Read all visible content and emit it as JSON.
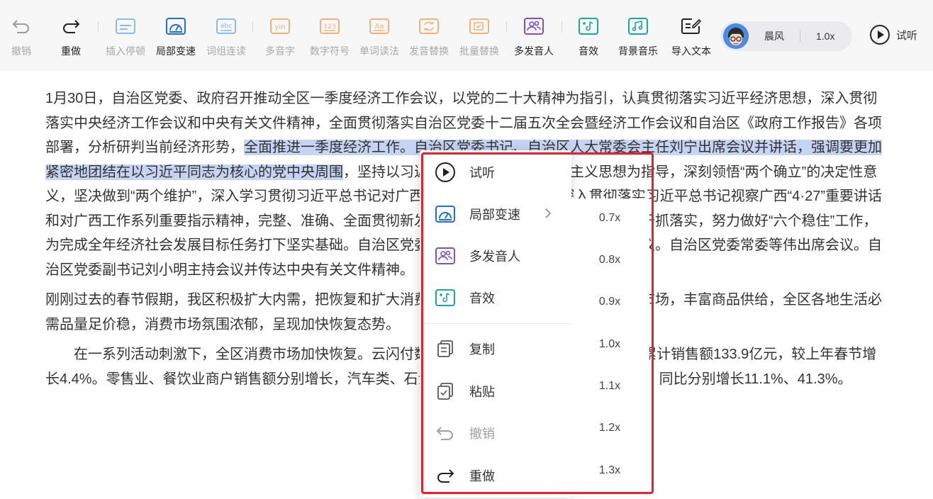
{
  "toolbar": {
    "undo": "撤销",
    "redo": "重做",
    "insert_pause": "插入停顿",
    "local_speed": "局部变速",
    "word_join": "词组连读",
    "polyphone": "多音字",
    "digit_symbol": "数字符号",
    "word_read": "单词读法",
    "pron_replace": "发音替换",
    "batch_replace": "批量替换",
    "multi_speaker": "多发音人",
    "sound_effect": "音效",
    "bgm": "背景音乐",
    "import_text": "导入文本",
    "icon_texts": {
      "abc": "abc",
      "yin": "yin",
      "num": "123",
      "aa": "Aa"
    }
  },
  "voice": {
    "name": "晨风",
    "speed": "1.0x"
  },
  "preview_button": "试听",
  "document": {
    "p1_before": "1月30日，自治区党委、政府召开推动全区一季度经济工作会议，以党的二十大精神为指引，认真贯彻落实习近平经济思想，深入贯彻落实中央经济工作会议和中央有关文件精神，全面贯彻落实自治区党委十二届五次全会暨经济工作会议和自治区《政府工作报告》各项部署，分析研判当前经济形势，",
    "p1_highlight": "全面推进一季度经济工作。自治区党委书记、自治区人大常委会主任刘宁出席会议并讲话，强调要更加紧密地团结在以习近平同志为核心的党中央周围",
    "p1_after": "，坚持以习近平新时代中国特色社会主义思想为指导，深刻领悟“两个确立”的决定性意义，坚决做到“两个维护”，深入学习贯彻习近平总书记对广西“五个更大”重要要求，深入贯彻落实习近平总书记视察广西“4·27”重要讲话和对广西工作系列重要指示精神，完整、准确、全面贯彻新发展理念，旗帜鲜明倡导重实效强实干抓落实，努力做好“六个稳住”工作，为完成全年经济社会发展目标任务打下坚实基础。自治区党委副书记、自治区主席蓝天立出席会议。自治区党委常委等伟出席会议。自治区党委副书记刘小明主持会议并传达中央有关文件精神。",
    "p2": "刚刚过去的春节假期，我区积极扩大内需，把恢复和扩大消费摆在优先位置，加快激活节庆假日市场，丰富商品供给，全区各地生活必需品量足价稳，消费市场氛围浓郁，呈现加快恢复态势。",
    "p3": "在一系列活动刺激下，全区消费市场加快恢复。云闪付数据显示，春节期间全区60万户商户累计销售额133.9亿元，较上年春节增长4.4%。零售业、餐饮业商户销售额分别增长，汽车类、石油及石油制品等出行类商品销售旺盛，同比分别增长11.1%、41.3%。"
  },
  "context_menu": {
    "items": [
      "试听",
      "局部变速",
      "多发音人",
      "音效",
      "复制",
      "粘贴",
      "撤销",
      "重做"
    ],
    "speed_options": [
      "0.7x",
      "0.8x",
      "0.9x",
      "1.0x",
      "1.1x",
      "1.2x",
      "1.3x"
    ]
  },
  "colors": {
    "accent_blue": "#1f6fd6",
    "teal": "#1aa89a",
    "purple": "#7b4fd6",
    "orange_disabled": "#f2b27a",
    "highlight": "#c6d4f4",
    "annotation_red": "#e8202a"
  }
}
